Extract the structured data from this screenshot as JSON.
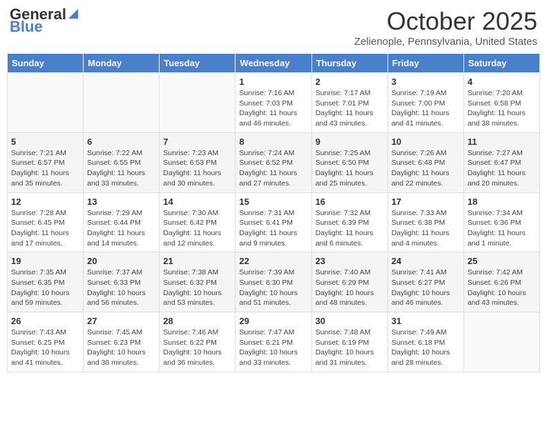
{
  "logo": {
    "general": "General",
    "blue": "Blue"
  },
  "title": "October 2025",
  "location": "Zelienople, Pennsylvania, United States",
  "days_of_week": [
    "Sunday",
    "Monday",
    "Tuesday",
    "Wednesday",
    "Thursday",
    "Friday",
    "Saturday"
  ],
  "weeks": [
    [
      {
        "day": "",
        "info": ""
      },
      {
        "day": "",
        "info": ""
      },
      {
        "day": "",
        "info": ""
      },
      {
        "day": "1",
        "info": "Sunrise: 7:16 AM\nSunset: 7:03 PM\nDaylight: 11 hours and 46 minutes."
      },
      {
        "day": "2",
        "info": "Sunrise: 7:17 AM\nSunset: 7:01 PM\nDaylight: 11 hours and 43 minutes."
      },
      {
        "day": "3",
        "info": "Sunrise: 7:19 AM\nSunset: 7:00 PM\nDaylight: 11 hours and 41 minutes."
      },
      {
        "day": "4",
        "info": "Sunrise: 7:20 AM\nSunset: 6:58 PM\nDaylight: 11 hours and 38 minutes."
      }
    ],
    [
      {
        "day": "5",
        "info": "Sunrise: 7:21 AM\nSunset: 6:57 PM\nDaylight: 11 hours and 35 minutes."
      },
      {
        "day": "6",
        "info": "Sunrise: 7:22 AM\nSunset: 6:55 PM\nDaylight: 11 hours and 33 minutes."
      },
      {
        "day": "7",
        "info": "Sunrise: 7:23 AM\nSunset: 6:53 PM\nDaylight: 11 hours and 30 minutes."
      },
      {
        "day": "8",
        "info": "Sunrise: 7:24 AM\nSunset: 6:52 PM\nDaylight: 11 hours and 27 minutes."
      },
      {
        "day": "9",
        "info": "Sunrise: 7:25 AM\nSunset: 6:50 PM\nDaylight: 11 hours and 25 minutes."
      },
      {
        "day": "10",
        "info": "Sunrise: 7:26 AM\nSunset: 6:48 PM\nDaylight: 11 hours and 22 minutes."
      },
      {
        "day": "11",
        "info": "Sunrise: 7:27 AM\nSunset: 6:47 PM\nDaylight: 11 hours and 20 minutes."
      }
    ],
    [
      {
        "day": "12",
        "info": "Sunrise: 7:28 AM\nSunset: 6:45 PM\nDaylight: 11 hours and 17 minutes."
      },
      {
        "day": "13",
        "info": "Sunrise: 7:29 AM\nSunset: 6:44 PM\nDaylight: 11 hours and 14 minutes."
      },
      {
        "day": "14",
        "info": "Sunrise: 7:30 AM\nSunset: 6:42 PM\nDaylight: 11 hours and 12 minutes."
      },
      {
        "day": "15",
        "info": "Sunrise: 7:31 AM\nSunset: 6:41 PM\nDaylight: 11 hours and 9 minutes."
      },
      {
        "day": "16",
        "info": "Sunrise: 7:32 AM\nSunset: 6:39 PM\nDaylight: 11 hours and 6 minutes."
      },
      {
        "day": "17",
        "info": "Sunrise: 7:33 AM\nSunset: 6:38 PM\nDaylight: 11 hours and 4 minutes."
      },
      {
        "day": "18",
        "info": "Sunrise: 7:34 AM\nSunset: 6:36 PM\nDaylight: 11 hours and 1 minute."
      }
    ],
    [
      {
        "day": "19",
        "info": "Sunrise: 7:35 AM\nSunset: 6:35 PM\nDaylight: 10 hours and 59 minutes."
      },
      {
        "day": "20",
        "info": "Sunrise: 7:37 AM\nSunset: 6:33 PM\nDaylight: 10 hours and 56 minutes."
      },
      {
        "day": "21",
        "info": "Sunrise: 7:38 AM\nSunset: 6:32 PM\nDaylight: 10 hours and 53 minutes."
      },
      {
        "day": "22",
        "info": "Sunrise: 7:39 AM\nSunset: 6:30 PM\nDaylight: 10 hours and 51 minutes."
      },
      {
        "day": "23",
        "info": "Sunrise: 7:40 AM\nSunset: 6:29 PM\nDaylight: 10 hours and 48 minutes."
      },
      {
        "day": "24",
        "info": "Sunrise: 7:41 AM\nSunset: 6:27 PM\nDaylight: 10 hours and 46 minutes."
      },
      {
        "day": "25",
        "info": "Sunrise: 7:42 AM\nSunset: 6:26 PM\nDaylight: 10 hours and 43 minutes."
      }
    ],
    [
      {
        "day": "26",
        "info": "Sunrise: 7:43 AM\nSunset: 6:25 PM\nDaylight: 10 hours and 41 minutes."
      },
      {
        "day": "27",
        "info": "Sunrise: 7:45 AM\nSunset: 6:23 PM\nDaylight: 10 hours and 38 minutes."
      },
      {
        "day": "28",
        "info": "Sunrise: 7:46 AM\nSunset: 6:22 PM\nDaylight: 10 hours and 36 minutes."
      },
      {
        "day": "29",
        "info": "Sunrise: 7:47 AM\nSunset: 6:21 PM\nDaylight: 10 hours and 33 minutes."
      },
      {
        "day": "30",
        "info": "Sunrise: 7:48 AM\nSunset: 6:19 PM\nDaylight: 10 hours and 31 minutes."
      },
      {
        "day": "31",
        "info": "Sunrise: 7:49 AM\nSunset: 6:18 PM\nDaylight: 10 hours and 28 minutes."
      },
      {
        "day": "",
        "info": ""
      }
    ]
  ]
}
